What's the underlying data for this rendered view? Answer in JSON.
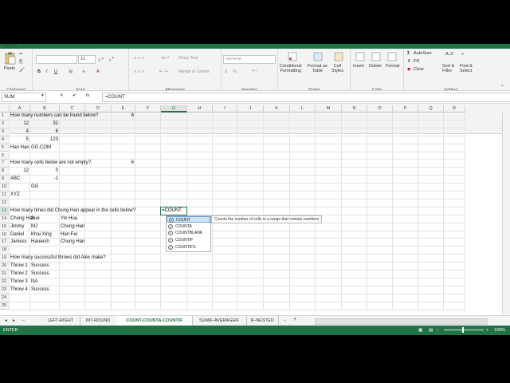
{
  "ribbon": {
    "clipboard": {
      "paste": "Paste",
      "label": "Clipboard"
    },
    "font": {
      "name": "",
      "size": "11",
      "label": "Font",
      "bold": "B",
      "italic": "I",
      "underline": "U"
    },
    "alignment": {
      "wrap": "Wrap Text",
      "merge": "Merge & Center",
      "label": "Alignment"
    },
    "number": {
      "format": "General",
      "currency": "$",
      "percent": "%",
      "comma": ",",
      "label": "Number"
    },
    "styles": {
      "conditional": "Conditional\nFormatting",
      "format_table": "Format as\nTable",
      "cell_styles": "Cell\nStyles",
      "label": "Styles"
    },
    "cells": {
      "insert": "Insert",
      "delete": "Delete",
      "format": "Format",
      "label": "Cells"
    },
    "editing": {
      "autosum": "AutoSum",
      "fill": "Fill",
      "clear": "Clear",
      "sort": "Sort &\nFilter",
      "find": "Find &\nSelect",
      "label": "Editing"
    }
  },
  "formula_bar": {
    "name_box": "SUM",
    "cancel": "✕",
    "enter": "✔",
    "fx": "fx",
    "formula": "=COUNT"
  },
  "columns": [
    "A",
    "B",
    "C",
    "D",
    "E",
    "F",
    "G",
    "H",
    "I",
    "J",
    "K",
    "L",
    "M",
    "N",
    "O",
    "P",
    "Q",
    "R"
  ],
  "rows": [
    "1",
    "2",
    "3",
    "4",
    "5",
    "6",
    "7",
    "8",
    "9",
    "10",
    "11",
    "12",
    "13",
    "14",
    "15",
    "16",
    "17",
    "18",
    "19",
    "20",
    "21",
    "22",
    "23",
    "24",
    "25"
  ],
  "cells": {
    "A1": "How many numbers can be found below?",
    "E1": "6",
    "A2": "12",
    "B2": "32",
    "A3": "4",
    "B3": "6",
    "A4": "5",
    "B4": "123",
    "A5": "Han Han",
    "B5": "GG.COM",
    "A7": "How many cells below are not empty?",
    "E7": "6",
    "A8": "12",
    "B8": "0",
    "A9": "ABC",
    "B9": "-1",
    "B10": "GG",
    "A11": "XYZ",
    "A13": "How many times did Chung Han appear in the cells below?",
    "G13": "=COUNT",
    "A14": "Chung Han",
    "B14": "Sue",
    "C14": "Yin Hua",
    "A15": "Jimmy",
    "B15": "MJ",
    "C15": "Chung Han",
    "A16": "Daniel",
    "B16": "Khai Xing",
    "C16": "Han Fei",
    "A17": "Jamess",
    "B17": "Hareesh",
    "C17": "Chung Han",
    "A19": "How many successful throws did Alex make?",
    "A20": "Throw 1",
    "B20": "Success",
    "A21": "Throw 2",
    "B21": "Success",
    "A22": "Throw 3",
    "B22": "NA",
    "A23": "Throw 4",
    "B23": "Success"
  },
  "autocomplete": {
    "items": [
      "COUNT",
      "COUNTA",
      "COUNTBLANK",
      "COUNTIF",
      "COUNTIFS"
    ],
    "tooltip": "Counts the number of cells in a range that contain numbers"
  },
  "sheet_tabs": [
    "LEFT-RIGHT",
    "INT-ROUND",
    "COUNT-COUNTA-COUNTIF",
    "SUMIF-AVERAGEIF",
    "IF-NESTED"
  ],
  "sheet_nav": {
    "ellipsis": "...",
    "add": "+"
  },
  "status": {
    "mode": "ENTER",
    "zoom": "100%"
  },
  "colors": {
    "accent": "#217346"
  }
}
